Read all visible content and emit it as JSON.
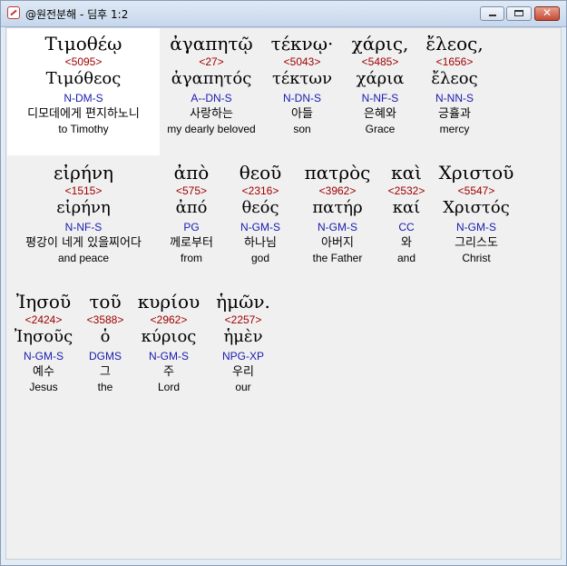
{
  "window": {
    "title": "@원전분해 - 딤후 1:2"
  },
  "rows": [
    [
      {
        "word": "Τιμοθέῳ",
        "strong": "<5095>",
        "lemma": "Τιμόθεος",
        "parse": "N-DM-S",
        "korean": "디모데에게 편지하노니",
        "english": "to Timothy"
      },
      {
        "word": "ἀγαπητῷ",
        "strong": "<27>",
        "lemma": "ἀγαπητός",
        "parse": "A--DN-S",
        "korean": "사랑하는",
        "english": "my dearly beloved"
      },
      {
        "word": "τέκνῳ·",
        "strong": "<5043>",
        "lemma": "τέκτων",
        "parse": "N-DN-S",
        "korean": "아들",
        "english": "son"
      },
      {
        "word": "χάρις,",
        "strong": "<5485>",
        "lemma": "χάρια",
        "parse": "N-NF-S",
        "korean": "은혜와",
        "english": "Grace"
      },
      {
        "word": "ἔλεος,",
        "strong": "<1656>",
        "lemma": "ἔλεος",
        "parse": "N-NN-S",
        "korean": "긍휼과",
        "english": "mercy"
      }
    ],
    [
      {
        "word": "εἰρήνη",
        "strong": "<1515>",
        "lemma": "εἰρήνη",
        "parse": "N-NF-S",
        "korean": "평강이 네게 있을찌어다",
        "english": "and peace"
      },
      {
        "word": "ἀπὸ",
        "strong": "<575>",
        "lemma": "ἀπό",
        "parse": "PG",
        "korean": "께로부터",
        "english": "from"
      },
      {
        "word": "θεοῦ",
        "strong": "<2316>",
        "lemma": "θεός",
        "parse": "N-GM-S",
        "korean": "하나님",
        "english": "god"
      },
      {
        "word": "πατρὸς",
        "strong": "<3962>",
        "lemma": "πατήρ",
        "parse": "N-GM-S",
        "korean": "아버지",
        "english": "the Father"
      },
      {
        "word": "καὶ",
        "strong": "<2532>",
        "lemma": "καί",
        "parse": "CC",
        "korean": "와",
        "english": "and"
      },
      {
        "word": "Χριστοῦ",
        "strong": "<5547>",
        "lemma": "Χριστός",
        "parse": "N-GM-S",
        "korean": "그리스도",
        "english": "Christ"
      }
    ],
    [
      {
        "word": "Ἰησοῦ",
        "strong": "<2424>",
        "lemma": "Ἰησοῦς",
        "parse": "N-GM-S",
        "korean": "예수",
        "english": "Jesus"
      },
      {
        "word": "τοῦ",
        "strong": "<3588>",
        "lemma": "ὁ",
        "parse": "DGMS",
        "korean": "그",
        "english": "the"
      },
      {
        "word": "κυρίου",
        "strong": "<2962>",
        "lemma": "κύριος",
        "parse": "N-GM-S",
        "korean": "주",
        "english": "Lord"
      },
      {
        "word": "ἡμῶν.",
        "strong": "<2257>",
        "lemma": "ἡμὲν",
        "parse": "NPG-XP",
        "korean": "우리",
        "english": "our"
      }
    ]
  ]
}
